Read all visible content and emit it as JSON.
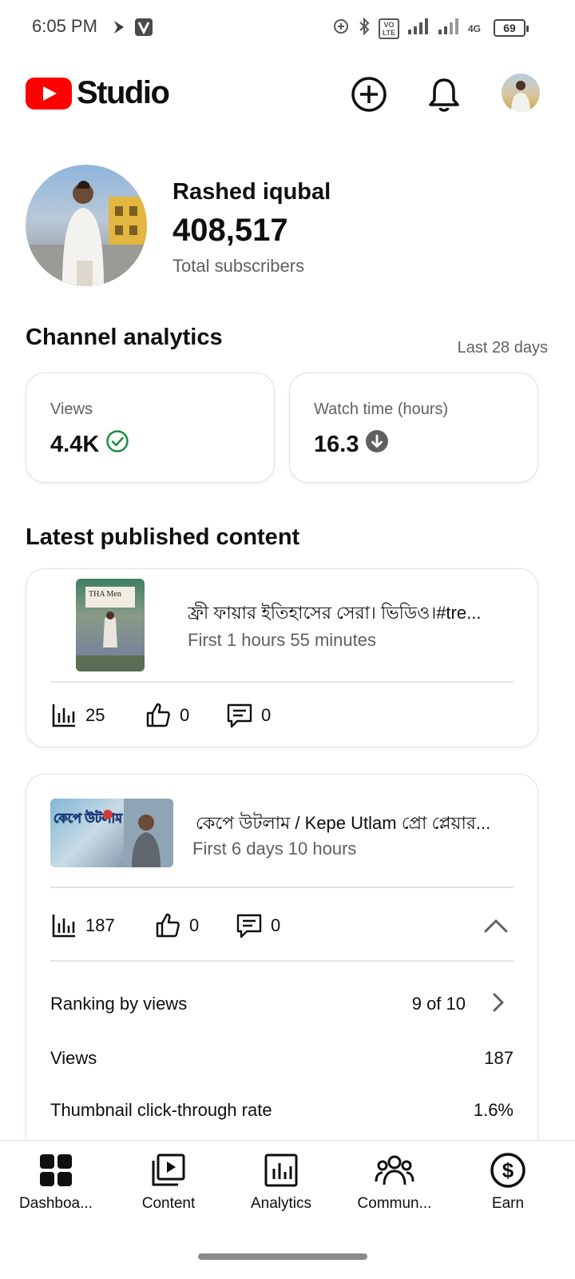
{
  "status_bar": {
    "time": "6:05 PM",
    "battery": "69",
    "network": "4G",
    "volte": "VoLTE"
  },
  "app_bar": {
    "logo_text": "Studio",
    "brand_color": "#ff0000",
    "icons": [
      "create-icon",
      "notifications-icon",
      "account-avatar"
    ]
  },
  "channel": {
    "name": "Rashed iqubal",
    "subscribers": "408,517",
    "subscribers_label": "Total subscribers"
  },
  "analytics": {
    "title": "Channel analytics",
    "period": "Last 28 days",
    "metrics": [
      {
        "label": "Views",
        "value": "4.4K",
        "status_icon": "check-circle-icon",
        "status_color": "#1e8e3e"
      },
      {
        "label": "Watch time (hours)",
        "value": "16.3",
        "status_icon": "arrow-down-circle-icon",
        "status_color": "#606060"
      }
    ]
  },
  "latest": {
    "title": "Latest published content",
    "items": [
      {
        "title": "ফ্রী ফায়ার ইতিহাসের সেরা।  ভিডিও।#tre...",
        "subtitle": "First 1 hours 55 minutes",
        "thumb_text": "THA Men",
        "views": "25",
        "likes": "0",
        "comments": "0"
      },
      {
        "title": "কেপে উটলাম / Kepe  Utlam প্রো প্লেয়ার...",
        "subtitle": "First 6 days 10 hours",
        "thumb_text": "কেপে উটলাম",
        "views": "187",
        "likes": "0",
        "comments": "0",
        "details": {
          "ranking_label": "Ranking by views",
          "ranking_value": "9 of 10",
          "views_label": "Views",
          "views_value": "187",
          "ctr_label": "Thumbnail click-through rate",
          "ctr_value": "1.6%"
        }
      }
    ]
  },
  "bottom_nav": {
    "items": [
      {
        "label": "Dashboa...",
        "icon": "dashboard-icon"
      },
      {
        "label": "Content",
        "icon": "content-icon"
      },
      {
        "label": "Analytics",
        "icon": "analytics-icon"
      },
      {
        "label": "Commun...",
        "icon": "community-icon"
      },
      {
        "label": "Earn",
        "icon": "earn-icon"
      }
    ]
  }
}
